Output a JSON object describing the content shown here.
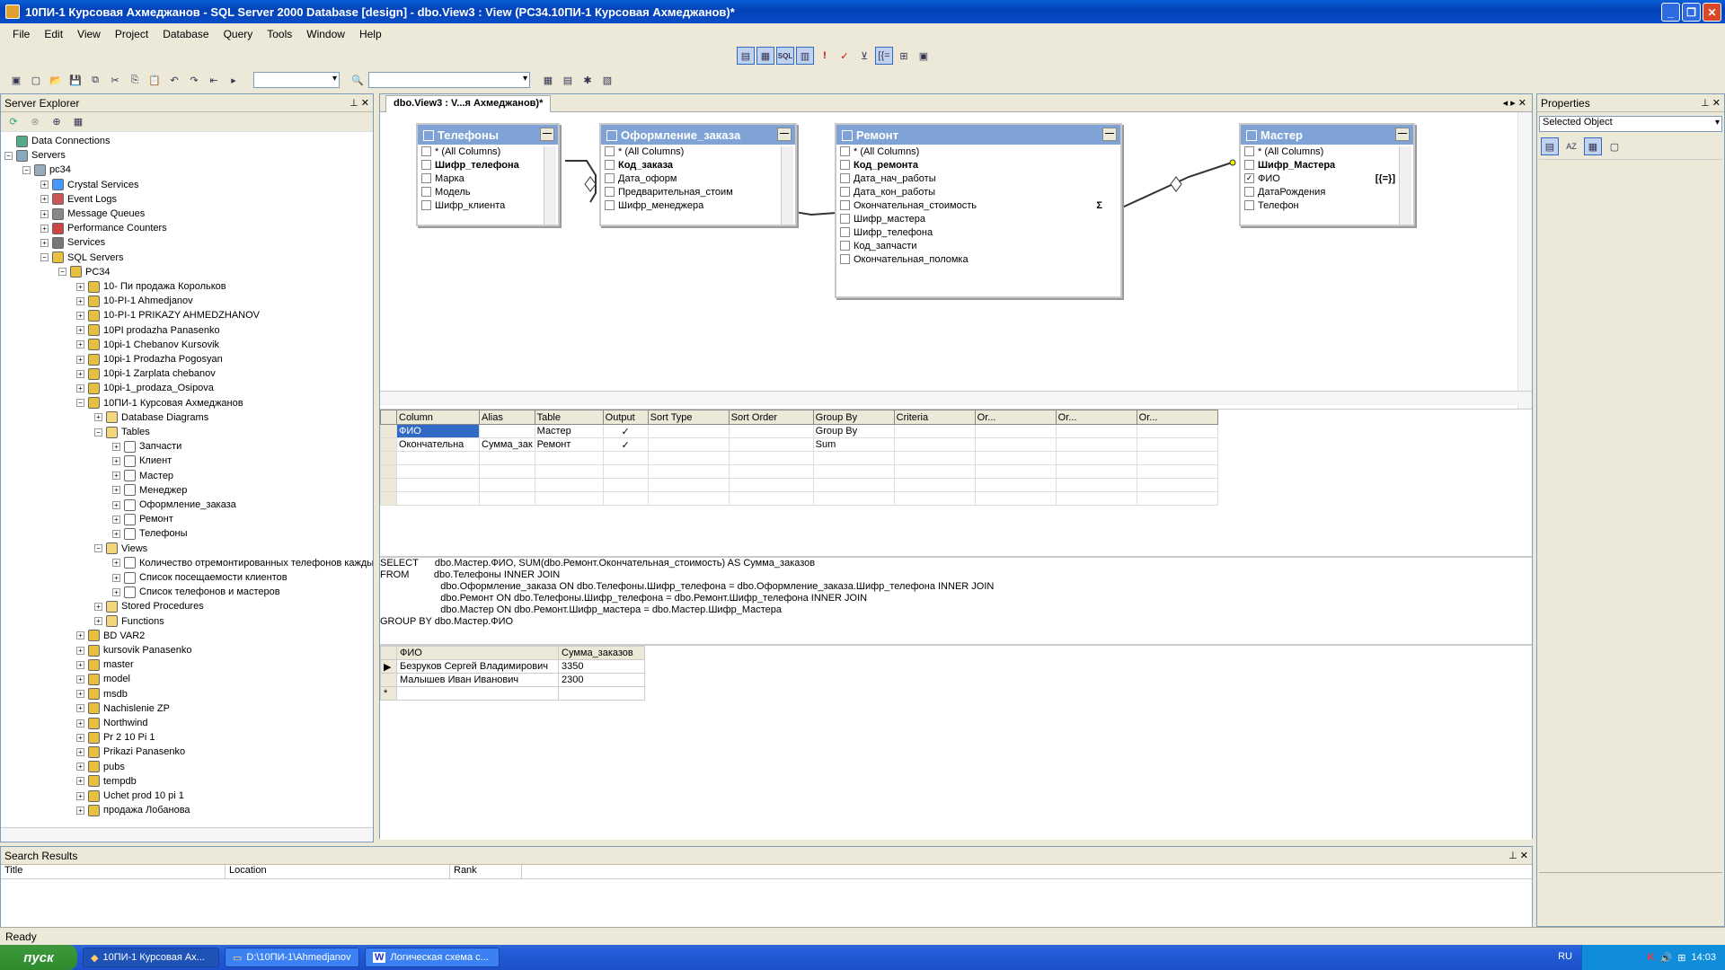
{
  "window": {
    "title": "10ПИ-1 Курсовая Ахмеджанов - SQL Server 2000 Database [design] - dbo.View3 : View (PC34.10ПИ-1 Курсовая Ахмеджанов)*"
  },
  "menu": [
    "File",
    "Edit",
    "View",
    "Project",
    "Database",
    "Query",
    "Tools",
    "Window",
    "Help"
  ],
  "server_explorer": {
    "title": "Server Explorer",
    "nodes": [
      {
        "label": "Data Connections",
        "level": 0,
        "pm": "",
        "icon": "data-connections-icon"
      },
      {
        "label": "Servers",
        "level": 0,
        "pm": "−",
        "icon": "servers-icon"
      },
      {
        "label": "pc34",
        "level": 1,
        "pm": "−",
        "icon": "computer-icon"
      },
      {
        "label": "Crystal Services",
        "level": 2,
        "pm": "+",
        "icon": "crystal-services-icon"
      },
      {
        "label": "Event Logs",
        "level": 2,
        "pm": "+",
        "icon": "event-logs-icon"
      },
      {
        "label": "Message Queues",
        "level": 2,
        "pm": "+",
        "icon": "message-queues-icon"
      },
      {
        "label": "Performance Counters",
        "level": 2,
        "pm": "+",
        "icon": "performance-counters-icon"
      },
      {
        "label": "Services",
        "level": 2,
        "pm": "+",
        "icon": "services-icon"
      },
      {
        "label": "SQL Servers",
        "level": 2,
        "pm": "−",
        "icon": "sql-servers-icon"
      },
      {
        "label": "PC34",
        "level": 3,
        "pm": "−",
        "icon": "sql-server-icon"
      },
      {
        "label": "10- Пи продажа Корольков",
        "level": 4,
        "pm": "+",
        "icon": "database-icon"
      },
      {
        "label": "10-PI-1 Ahmedjanov",
        "level": 4,
        "pm": "+",
        "icon": "database-icon"
      },
      {
        "label": "10-PI-1 PRIKAZY AHMEDZHANOV",
        "level": 4,
        "pm": "+",
        "icon": "database-icon"
      },
      {
        "label": "10PI prodazha Panasenko",
        "level": 4,
        "pm": "+",
        "icon": "database-icon"
      },
      {
        "label": "10pi-1 Chebanov Kursovik",
        "level": 4,
        "pm": "+",
        "icon": "database-icon"
      },
      {
        "label": "10pi-1 Prodazha Pogosyan",
        "level": 4,
        "pm": "+",
        "icon": "database-icon"
      },
      {
        "label": "10pi-1 Zarplata chebanov",
        "level": 4,
        "pm": "+",
        "icon": "database-icon"
      },
      {
        "label": "10pi-1_prodaza_Osipova",
        "level": 4,
        "pm": "+",
        "icon": "database-icon"
      },
      {
        "label": "10ПИ-1 Курсовая Ахмеджанов",
        "level": 4,
        "pm": "−",
        "icon": "database-icon"
      },
      {
        "label": "Database Diagrams",
        "level": 5,
        "pm": "+",
        "icon": "folder-icon"
      },
      {
        "label": "Tables",
        "level": 5,
        "pm": "−",
        "icon": "folder-icon"
      },
      {
        "label": "Запчасти",
        "level": 6,
        "pm": "+",
        "icon": "table-icon"
      },
      {
        "label": "Клиент",
        "level": 6,
        "pm": "+",
        "icon": "table-icon"
      },
      {
        "label": "Мастер",
        "level": 6,
        "pm": "+",
        "icon": "table-icon"
      },
      {
        "label": "Менеджер",
        "level": 6,
        "pm": "+",
        "icon": "table-icon"
      },
      {
        "label": "Оформление_заказа",
        "level": 6,
        "pm": "+",
        "icon": "table-icon"
      },
      {
        "label": "Ремонт",
        "level": 6,
        "pm": "+",
        "icon": "table-icon"
      },
      {
        "label": "Телефоны",
        "level": 6,
        "pm": "+",
        "icon": "table-icon"
      },
      {
        "label": "Views",
        "level": 5,
        "pm": "−",
        "icon": "folder-icon"
      },
      {
        "label": "Количество отремонтированных телефонов каждым мастером",
        "level": 6,
        "pm": "+",
        "icon": "view-icon"
      },
      {
        "label": "Список посещаемости клиентов",
        "level": 6,
        "pm": "+",
        "icon": "view-icon"
      },
      {
        "label": "Список телефонов и мастеров",
        "level": 6,
        "pm": "+",
        "icon": "view-icon"
      },
      {
        "label": "Stored Procedures",
        "level": 5,
        "pm": "+",
        "icon": "folder-icon"
      },
      {
        "label": "Functions",
        "level": 5,
        "pm": "+",
        "icon": "folder-icon"
      },
      {
        "label": "BD VAR2",
        "level": 4,
        "pm": "+",
        "icon": "database-icon"
      },
      {
        "label": "kursovik Panasenko",
        "level": 4,
        "pm": "+",
        "icon": "database-icon"
      },
      {
        "label": "master",
        "level": 4,
        "pm": "+",
        "icon": "database-icon"
      },
      {
        "label": "model",
        "level": 4,
        "pm": "+",
        "icon": "database-icon"
      },
      {
        "label": "msdb",
        "level": 4,
        "pm": "+",
        "icon": "database-icon"
      },
      {
        "label": "Nachislenie ZP",
        "level": 4,
        "pm": "+",
        "icon": "database-icon"
      },
      {
        "label": "Northwind",
        "level": 4,
        "pm": "+",
        "icon": "database-icon"
      },
      {
        "label": "Pr 2 10 Pi 1",
        "level": 4,
        "pm": "+",
        "icon": "database-icon"
      },
      {
        "label": "Prikazi  Panasenko",
        "level": 4,
        "pm": "+",
        "icon": "database-icon"
      },
      {
        "label": "pubs",
        "level": 4,
        "pm": "+",
        "icon": "database-icon"
      },
      {
        "label": "tempdb",
        "level": 4,
        "pm": "+",
        "icon": "database-icon"
      },
      {
        "label": "Uchet prod 10 pi 1",
        "level": 4,
        "pm": "+",
        "icon": "database-icon"
      },
      {
        "label": "продажа Лобанова",
        "level": 4,
        "pm": "+",
        "icon": "database-icon"
      }
    ]
  },
  "document": {
    "tab": "dbo.View3 : V...я Ахмеджанов)*"
  },
  "diagram_tables": [
    {
      "name": "Телефоны",
      "columns": [
        {
          "label": "* (All Columns)",
          "bold": false,
          "checked": false
        },
        {
          "label": "Шифр_телефона",
          "bold": true,
          "checked": false
        },
        {
          "label": "Марка",
          "bold": false,
          "checked": false
        },
        {
          "label": "Модель",
          "bold": false,
          "checked": false
        },
        {
          "label": "Шифр_клиента",
          "bold": false,
          "checked": false
        }
      ]
    },
    {
      "name": "Оформление_заказа",
      "columns": [
        {
          "label": "* (All Columns)",
          "bold": false,
          "checked": false
        },
        {
          "label": "Код_заказа",
          "bold": true,
          "checked": false
        },
        {
          "label": "Дата_оформ",
          "bold": false,
          "checked": false
        },
        {
          "label": "Предварительная_стоим",
          "bold": false,
          "checked": false
        },
        {
          "label": "Шифр_менеджера",
          "bold": false,
          "checked": false
        }
      ]
    },
    {
      "name": "Ремонт",
      "columns": [
        {
          "label": "* (All Columns)",
          "bold": false,
          "checked": false
        },
        {
          "label": "Код_ремонта",
          "bold": true,
          "checked": false
        },
        {
          "label": "Дата_нач_работы",
          "bold": false,
          "checked": false
        },
        {
          "label": "Дата_кон_работы",
          "bold": false,
          "checked": false
        },
        {
          "label": "Окончательная_стоимость",
          "bold": false,
          "checked": false,
          "marker": "Σ"
        },
        {
          "label": "Шифр_мастера",
          "bold": false,
          "checked": false
        },
        {
          "label": "Шифр_телефона",
          "bold": false,
          "checked": false
        },
        {
          "label": "Код_запчасти",
          "bold": false,
          "checked": false
        },
        {
          "label": "Окончательная_поломка",
          "bold": false,
          "checked": false
        }
      ]
    },
    {
      "name": "Мастер",
      "columns": [
        {
          "label": "* (All Columns)",
          "bold": false,
          "checked": false
        },
        {
          "label": "Шифр_Мастера",
          "bold": true,
          "checked": false
        },
        {
          "label": "ФИО",
          "bold": false,
          "checked": true,
          "marker": "[{=}]"
        },
        {
          "label": "ДатаРождения",
          "bold": false,
          "checked": false
        },
        {
          "label": "Телефон",
          "bold": false,
          "checked": false
        }
      ]
    }
  ],
  "criteria_grid": {
    "headers": [
      "Column",
      "Alias",
      "Table",
      "Output",
      "Sort Type",
      "Sort Order",
      "Group By",
      "Criteria",
      "Or...",
      "Or...",
      "Or..."
    ],
    "rows": [
      [
        "ФИО",
        "",
        "Мастер",
        "✓",
        "",
        "",
        "Group By",
        "",
        "",
        "",
        ""
      ],
      [
        "Окончательна",
        "Сумма_зак",
        "Ремонт",
        "✓",
        "",
        "",
        "Sum",
        "",
        "",
        "",
        ""
      ]
    ]
  },
  "sql_lines": [
    "SELECT      dbo.Мастер.ФИО, SUM(dbo.Ремонт.Окончательная_стоимость) AS Сумма_заказов",
    "FROM         dbo.Телефоны INNER JOIN",
    "                      dbo.Оформление_заказа ON dbo.Телефоны.Шифр_телефона = dbo.Оформление_заказа.Шифр_телефона INNER JOIN",
    "                      dbo.Ремонт ON dbo.Телефоны.Шифр_телефона = dbo.Ремонт.Шифр_телефона INNER JOIN",
    "                      dbo.Мастер ON dbo.Ремонт.Шифр_мастера = dbo.Мастер.Шифр_Мастера",
    "GROUP BY dbo.Мастер.ФИО"
  ],
  "results": {
    "headers": [
      "ФИО",
      "Сумма_заказов"
    ],
    "rows": [
      [
        "Безруков Сергей Владимирович",
        "3350"
      ],
      [
        "Малышев Иван Иванович",
        "2300"
      ]
    ],
    "new_row_marker": "*"
  },
  "properties": {
    "title": "Properties",
    "selected": "Selected Object"
  },
  "search_results": {
    "title": "Search Results",
    "headers": [
      "Title",
      "Location",
      "Rank"
    ]
  },
  "status": {
    "text": "Ready"
  },
  "taskbar": {
    "start": "пуск",
    "tasks": [
      "10ПИ-1 Курсовая Ах...",
      "D:\\10ПИ-1\\Ahmedjanov",
      "Логическая схема с..."
    ],
    "lang": "RU",
    "clock": "14:03"
  }
}
